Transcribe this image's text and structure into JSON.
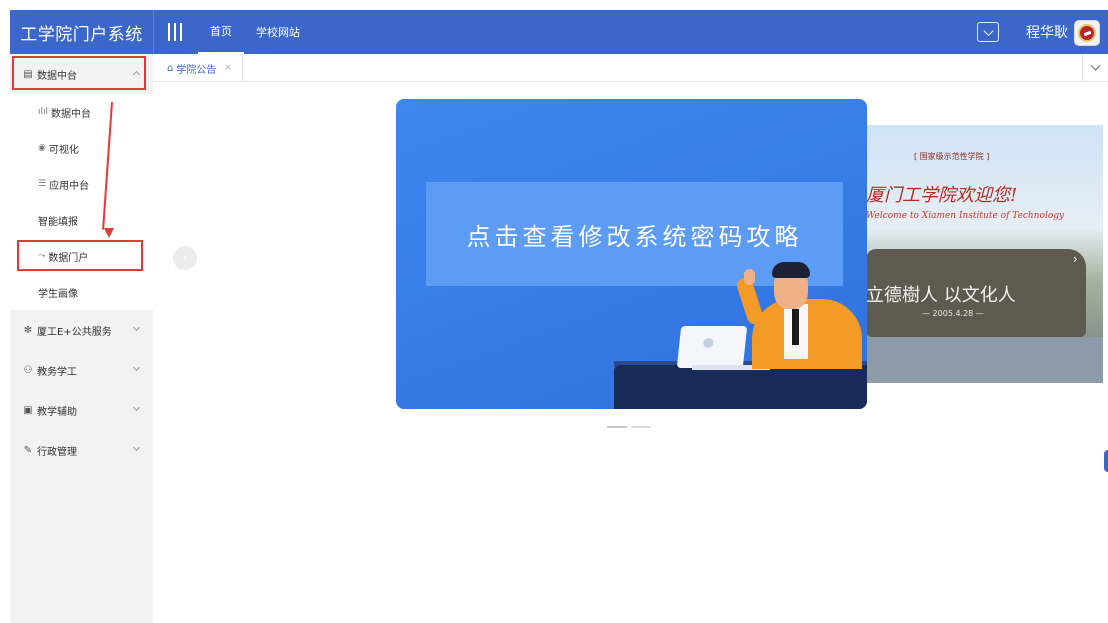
{
  "app": {
    "title": "工学院门户系统"
  },
  "header": {
    "nav": [
      {
        "label": "首页",
        "active": true
      },
      {
        "label": "学校网站",
        "active": false
      }
    ],
    "user_name": "程华耿"
  },
  "sidebar": {
    "groups": [
      {
        "icon": "database-icon",
        "glyph": "▤",
        "label": "数据中台",
        "expanded": true,
        "items": [
          {
            "icon": "bar-chart-icon",
            "glyph": "ılıl",
            "label": "数据中台"
          },
          {
            "icon": "eye-icon",
            "glyph": "◉",
            "label": "可视化"
          },
          {
            "icon": "list-icon",
            "glyph": "☰",
            "label": "应用中台"
          },
          {
            "icon": "",
            "glyph": "",
            "label": "智能填报"
          },
          {
            "icon": "portal-icon",
            "glyph": "⤳",
            "label": "数据门户"
          },
          {
            "icon": "",
            "glyph": "",
            "label": "学生画像"
          }
        ]
      },
      {
        "icon": "star-icon",
        "glyph": "✻",
        "label": "厦工E+公共服务",
        "expanded": false
      },
      {
        "icon": "users-icon",
        "glyph": "⚇",
        "label": "教务学工",
        "expanded": false
      },
      {
        "icon": "book-icon",
        "glyph": "▣",
        "label": "教学辅助",
        "expanded": false
      },
      {
        "icon": "pen-icon",
        "glyph": "✎",
        "label": "行政管理",
        "expanded": false
      }
    ]
  },
  "tabs": [
    {
      "icon": "home-icon",
      "glyph": "⌂",
      "label": "学院公告",
      "close": "×"
    }
  ],
  "carousel": {
    "main_slide_text": "点击查看修改系统密码攻略",
    "side_slide": {
      "small_sign": "[ 国家级示范性学院 ]",
      "welcome": "厦门工学院欢迎您!",
      "welcome_en": "Welcome to Xiamen Institute of Technology",
      "motto": "立德樹人  以文化人",
      "date": "— 2005.4.28 —"
    },
    "prev_glyph": "‹",
    "next_glyph": "›",
    "slide_count": 2,
    "active_index": 0
  },
  "colors": {
    "primary": "#3a67c9",
    "highlight": "#e53935",
    "slide_blue": "#3f86f0"
  }
}
